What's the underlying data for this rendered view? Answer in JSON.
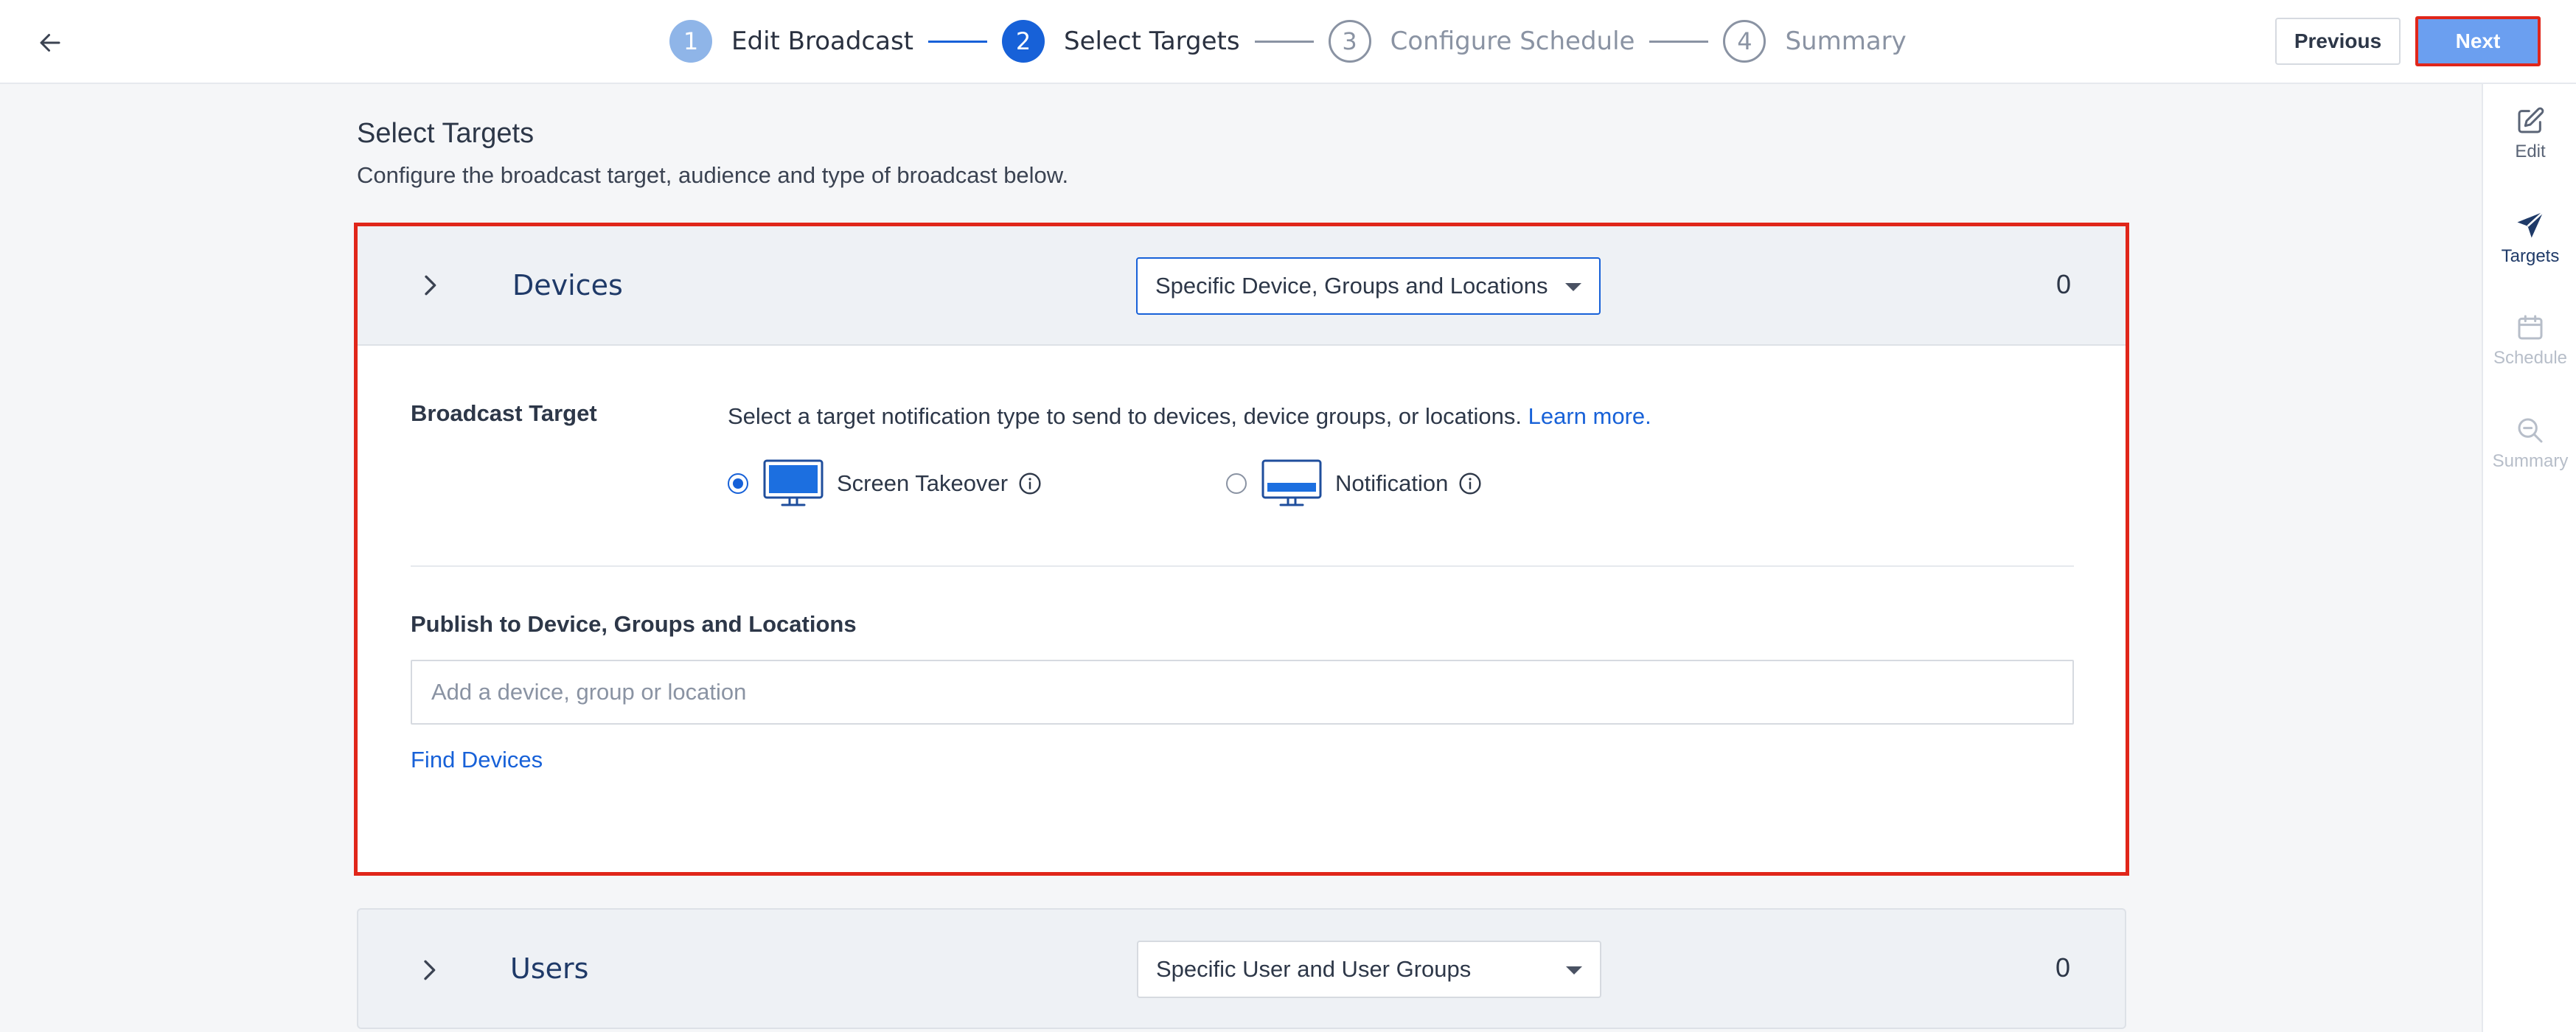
{
  "stepper": {
    "steps": [
      {
        "number": "1",
        "label": "Edit Broadcast",
        "state": "done"
      },
      {
        "number": "2",
        "label": "Select Targets",
        "state": "active"
      },
      {
        "number": "3",
        "label": "Configure Schedule",
        "state": "pending"
      },
      {
        "number": "4",
        "label": "Summary",
        "state": "pending"
      }
    ]
  },
  "header": {
    "back_icon": "arrow-left-icon",
    "previous_label": "Previous",
    "next_label": "Next"
  },
  "rail": {
    "items": [
      {
        "label": "Edit",
        "icon": "edit-icon",
        "state": "normal"
      },
      {
        "label": "Targets",
        "icon": "paper-plane-icon",
        "state": "active"
      },
      {
        "label": "Schedule",
        "icon": "calendar-icon",
        "state": "disabled"
      },
      {
        "label": "Summary",
        "icon": "search-icon",
        "state": "disabled"
      }
    ]
  },
  "page": {
    "title": "Select Targets",
    "subtitle": "Configure the broadcast target, audience and type of broadcast below."
  },
  "devices": {
    "title": "Devices",
    "select_value": "Specific Device, Groups and Locations",
    "count": "0",
    "broadcast_target_label": "Broadcast Target",
    "description": "Select a target notification type to send to devices, device groups, or locations.",
    "learn_more": "Learn more.",
    "options": [
      {
        "label": "Screen Takeover",
        "checked": true
      },
      {
        "label": "Notification",
        "checked": false
      }
    ],
    "publish_label": "Publish to Device, Groups and Locations",
    "input_placeholder": "Add a device, group or location",
    "input_value": "",
    "find_devices": "Find Devices"
  },
  "users": {
    "title": "Users",
    "select_value": "Specific User and User Groups",
    "count": "0"
  },
  "colors": {
    "primary": "#1761d8",
    "highlight": "#e0261a",
    "next_button": "#6b9ff0"
  }
}
